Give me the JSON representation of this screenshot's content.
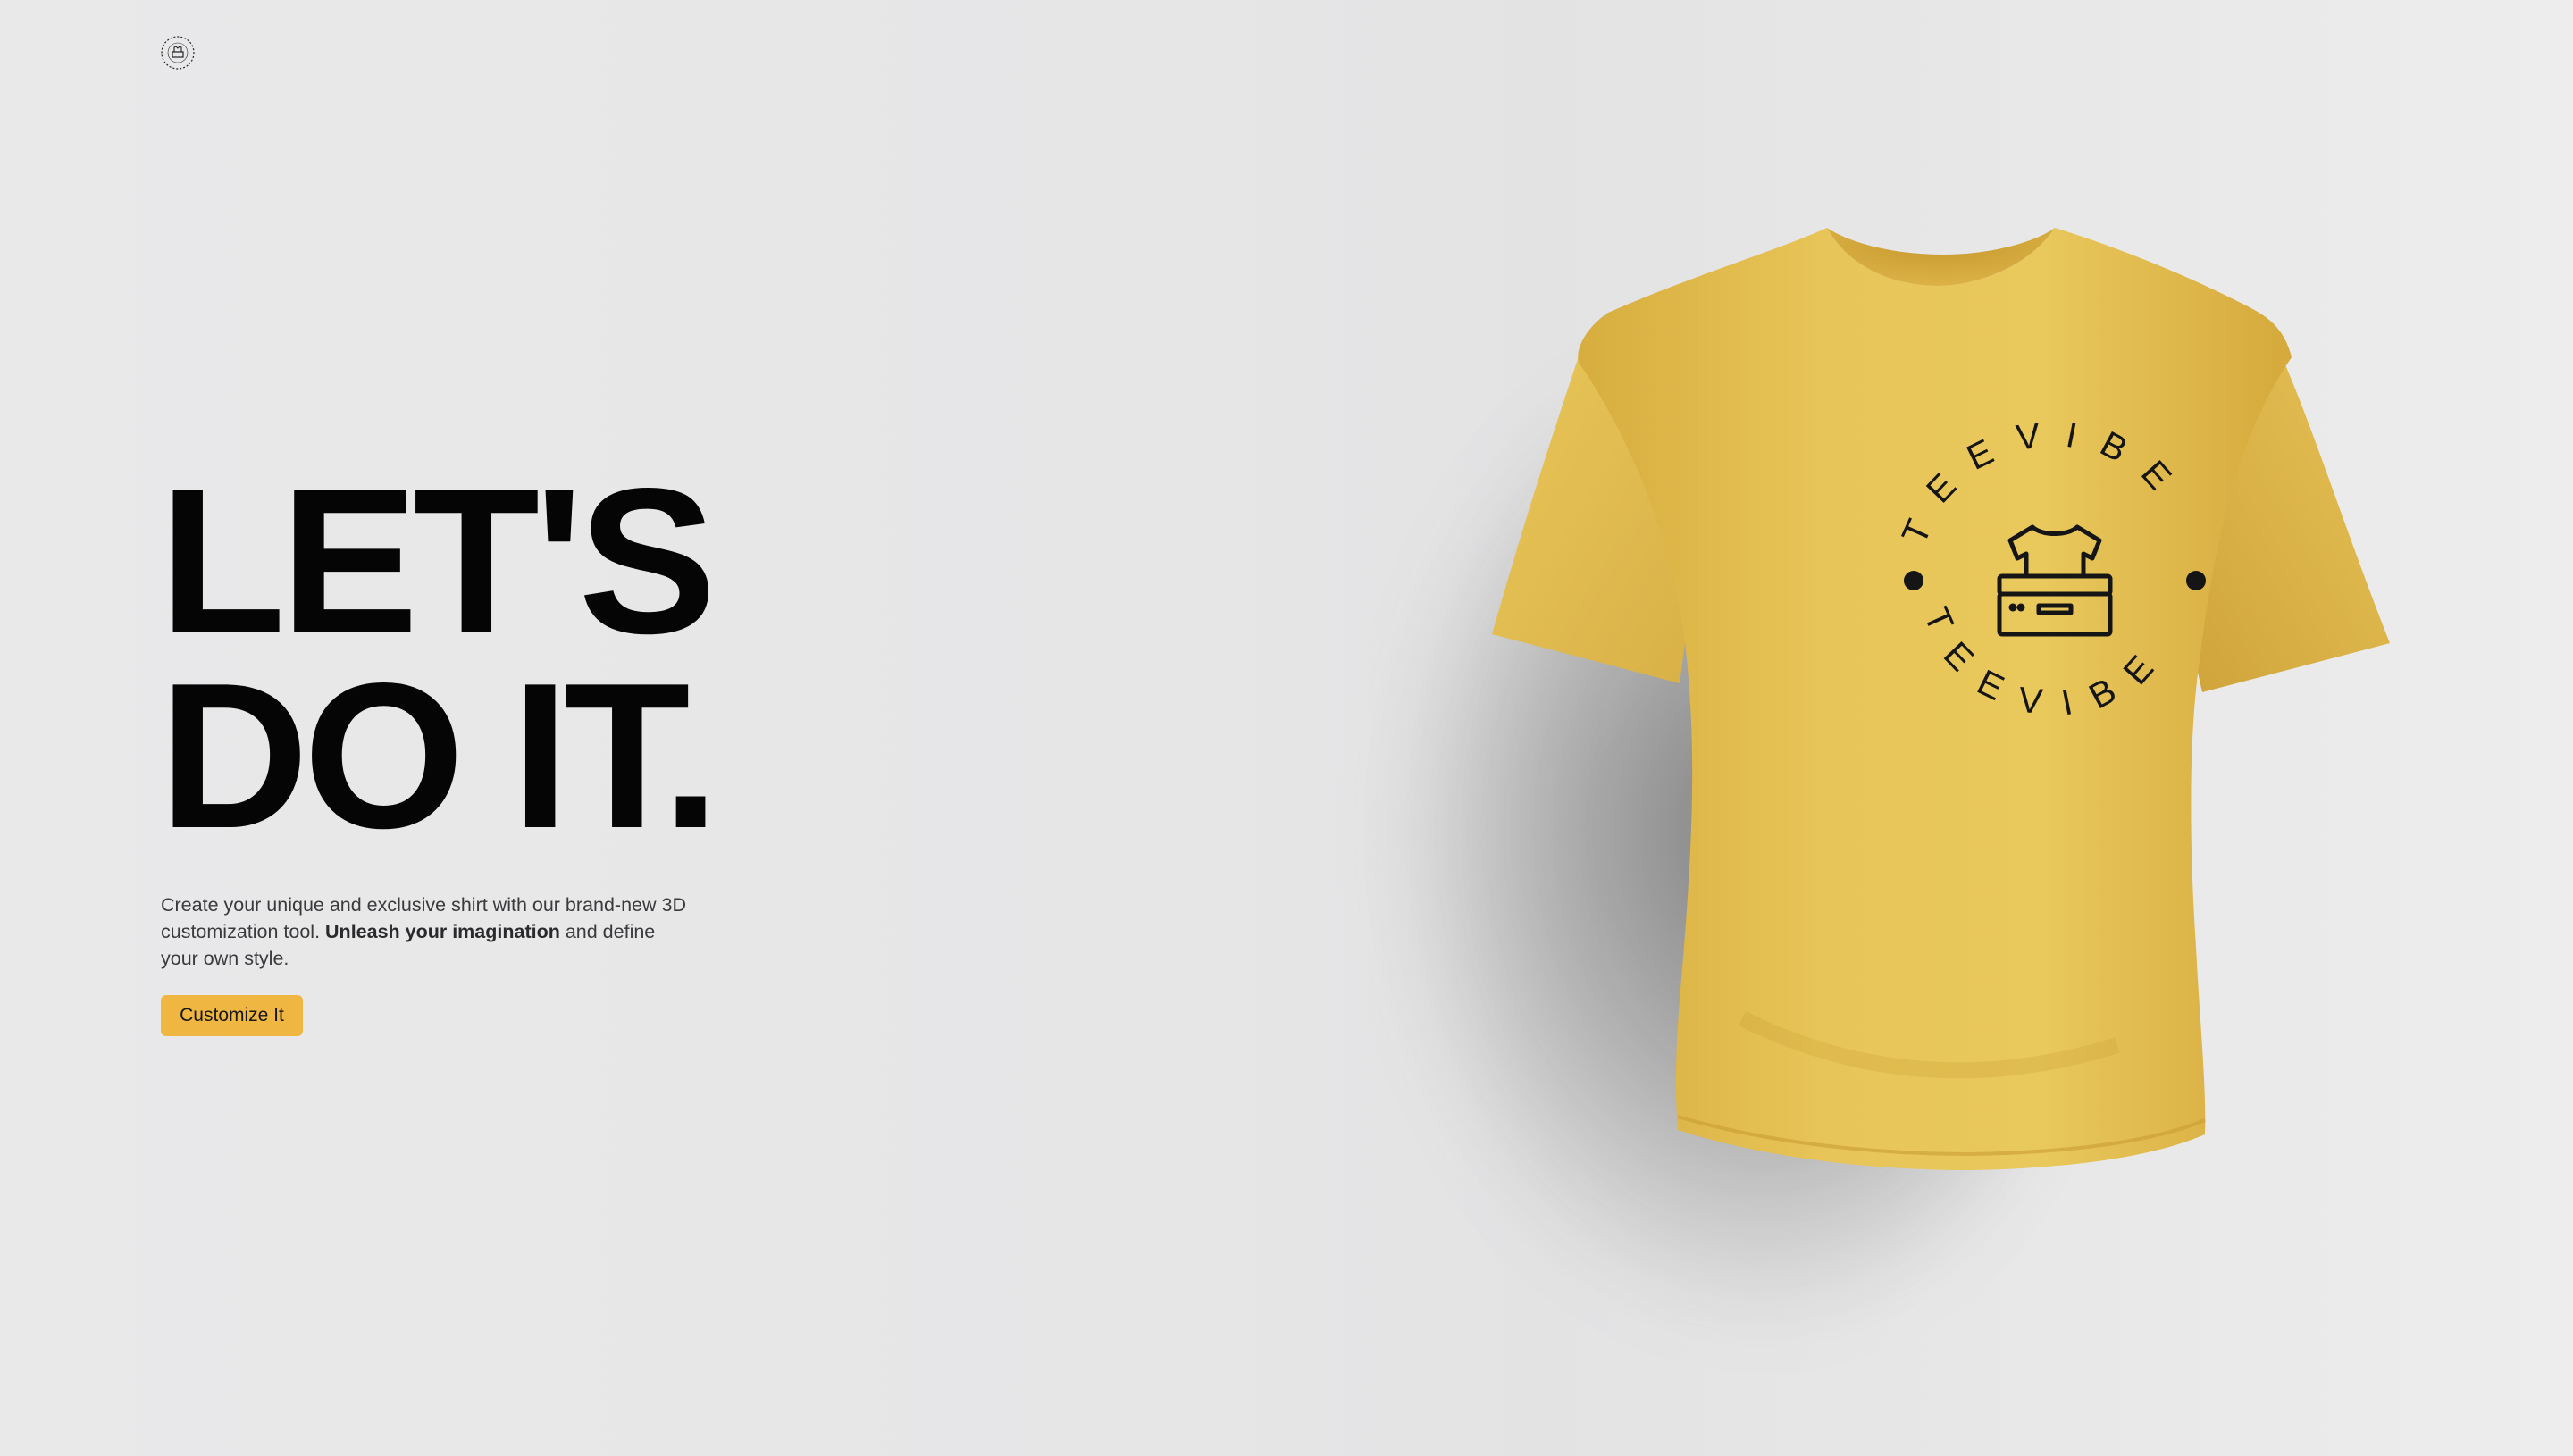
{
  "brand": {
    "logo_icon": "teevibe-badge-icon",
    "name": "TEEVIBE"
  },
  "hero": {
    "headline_line1": "LET'S",
    "headline_line2": "DO IT.",
    "intro_part1": "Create your unique and exclusive shirt with our brand-new 3D customization tool. ",
    "intro_bold": "Unleash your imagination",
    "intro_part2": " and define your own style.",
    "cta_label": "Customize It"
  },
  "shirt": {
    "color": "#e6c052",
    "print_text": "TEEVIBE",
    "print_icon": "tshirt-printer-icon"
  },
  "colors": {
    "accent": "#efb741",
    "background": "#e6e6e7",
    "text": "#050505"
  }
}
